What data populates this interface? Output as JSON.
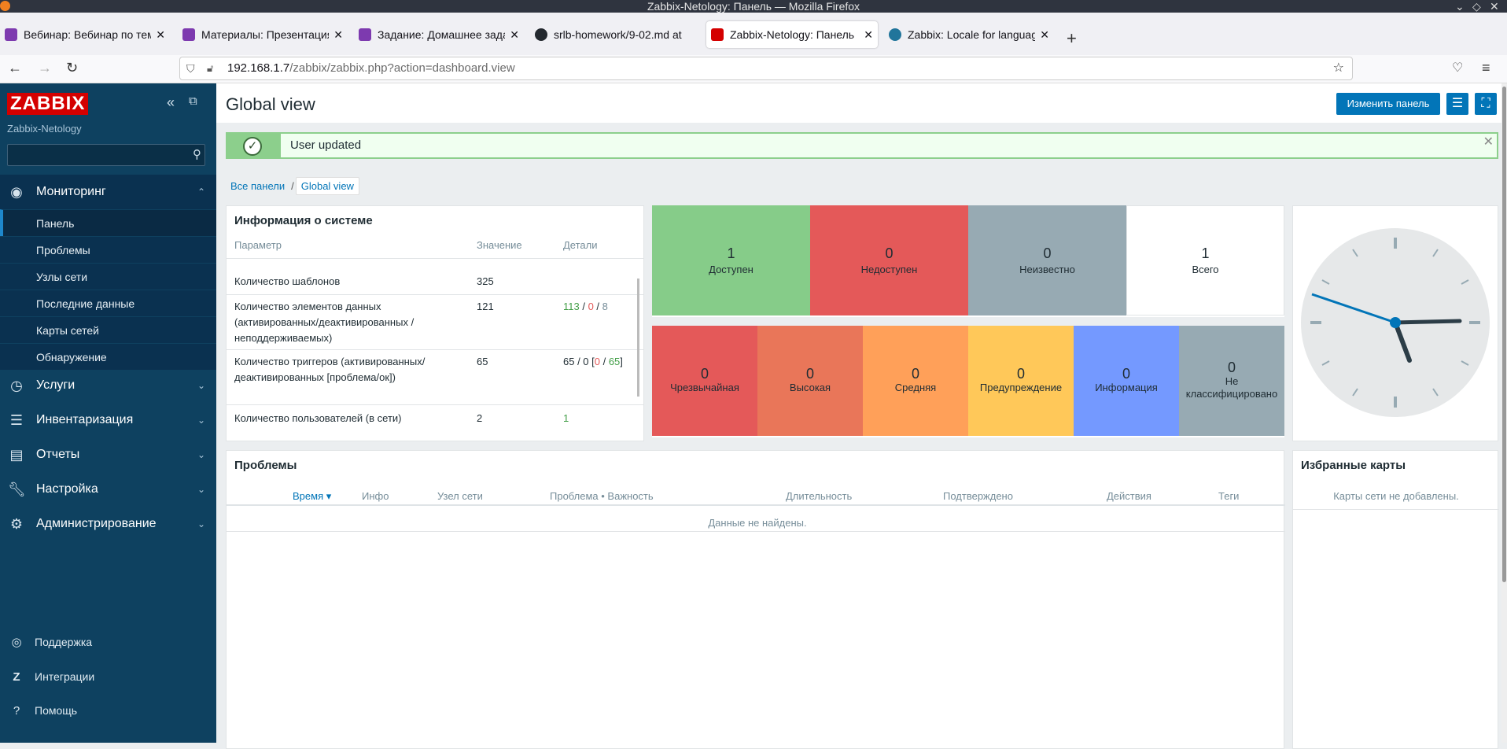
{
  "window": {
    "title": "Zabbix-Netology: Панель — Mozilla Firefox"
  },
  "tabs": [
    {
      "label": "Вебинар: Вебинар по теме",
      "color": "#7d3aaf"
    },
    {
      "label": "Материалы: Презентация",
      "color": "#7d3aaf"
    },
    {
      "label": "Задание: Домашнее задан",
      "color": "#7d3aaf"
    },
    {
      "label": "srlb-homework/9-02.md at",
      "color": "#24292f"
    },
    {
      "label": "Zabbix-Netology: Панель",
      "color": "#d40000"
    },
    {
      "label": "Zabbix: Locale for languag",
      "color": "#21759b"
    }
  ],
  "url": {
    "host": "192.168.1.7",
    "path": "/zabbix/zabbix.php?action=dashboard.view"
  },
  "sidebar": {
    "logo": "ZABBIX",
    "brand": "Zabbix-Netology",
    "menu": [
      {
        "label": "Мониторинг",
        "icon": "eye-icon"
      },
      {
        "label": "Услуги",
        "icon": "clock-icon"
      },
      {
        "label": "Инвентаризация",
        "icon": "list-icon"
      },
      {
        "label": "Отчеты",
        "icon": "bar-chart-icon"
      },
      {
        "label": "Настройка",
        "icon": "wrench-icon"
      },
      {
        "label": "Администрирование",
        "icon": "gear-icon"
      }
    ],
    "submenu": [
      "Панель",
      "Проблемы",
      "Узлы сети",
      "Последние данные",
      "Карты сетей",
      "Обнаружение"
    ],
    "footer": [
      {
        "label": "Поддержка",
        "icon": "support-icon"
      },
      {
        "label": "Интеграции",
        "icon": "zabbix-z-icon"
      },
      {
        "label": "Помощь",
        "icon": "question-icon"
      }
    ]
  },
  "page": {
    "title": "Global view",
    "edit_button": "Изменить панель"
  },
  "message": {
    "text": "User updated"
  },
  "breadcrumbs": {
    "all": "Все панели",
    "current": "Global view"
  },
  "system_info": {
    "title": "Информация о системе",
    "headers": [
      "Параметр",
      "Значение",
      "Детали"
    ],
    "rows": [
      {
        "param": "Количество шаблонов",
        "value": "325"
      },
      {
        "param": "Количество элементов данных (активированных/деактивированных /неподдерживаемых)",
        "value": "121",
        "d1": "113",
        "d2": "0",
        "d3": "8"
      },
      {
        "param": "Количество триггеров (активированных/деактивированных [проблема/ок])",
        "value": "65",
        "d0": "65 / 0 [",
        "d1": "0",
        "d2": "65",
        "d3": "]"
      },
      {
        "param": "Количество пользователей (в сети)",
        "value": "2",
        "d1": "1"
      }
    ]
  },
  "host_availability": [
    {
      "count": "1",
      "label": "Доступен",
      "color": "#86cc89"
    },
    {
      "count": "0",
      "label": "Недоступен",
      "color": "#e45959"
    },
    {
      "count": "0",
      "label": "Неизвестно",
      "color": "#97aab3"
    },
    {
      "count": "1",
      "label": "Всего",
      "color": "#ffffff"
    }
  ],
  "problems_by_severity": [
    {
      "count": "0",
      "label": "Чрезвычайная",
      "color": "#e45959"
    },
    {
      "count": "0",
      "label": "Высокая",
      "color": "#e97659"
    },
    {
      "count": "0",
      "label": "Средняя",
      "color": "#ffa059"
    },
    {
      "count": "0",
      "label": "Предупреждение",
      "color": "#ffc859"
    },
    {
      "count": "0",
      "label": "Информация",
      "color": "#7499ff"
    },
    {
      "count": "0",
      "label": "Не классифицировано",
      "color": "#97aab3"
    }
  ],
  "problems": {
    "title": "Проблемы",
    "headers": [
      "Время ▾",
      "Инфо",
      "Узел сети",
      "Проблема • Важность",
      "Длительность",
      "Подтверждено",
      "Действия",
      "Теги"
    ],
    "empty": "Данные не найдены."
  },
  "fav_maps": {
    "title": "Избранные карты",
    "empty": "Карты сети не добавлены."
  }
}
